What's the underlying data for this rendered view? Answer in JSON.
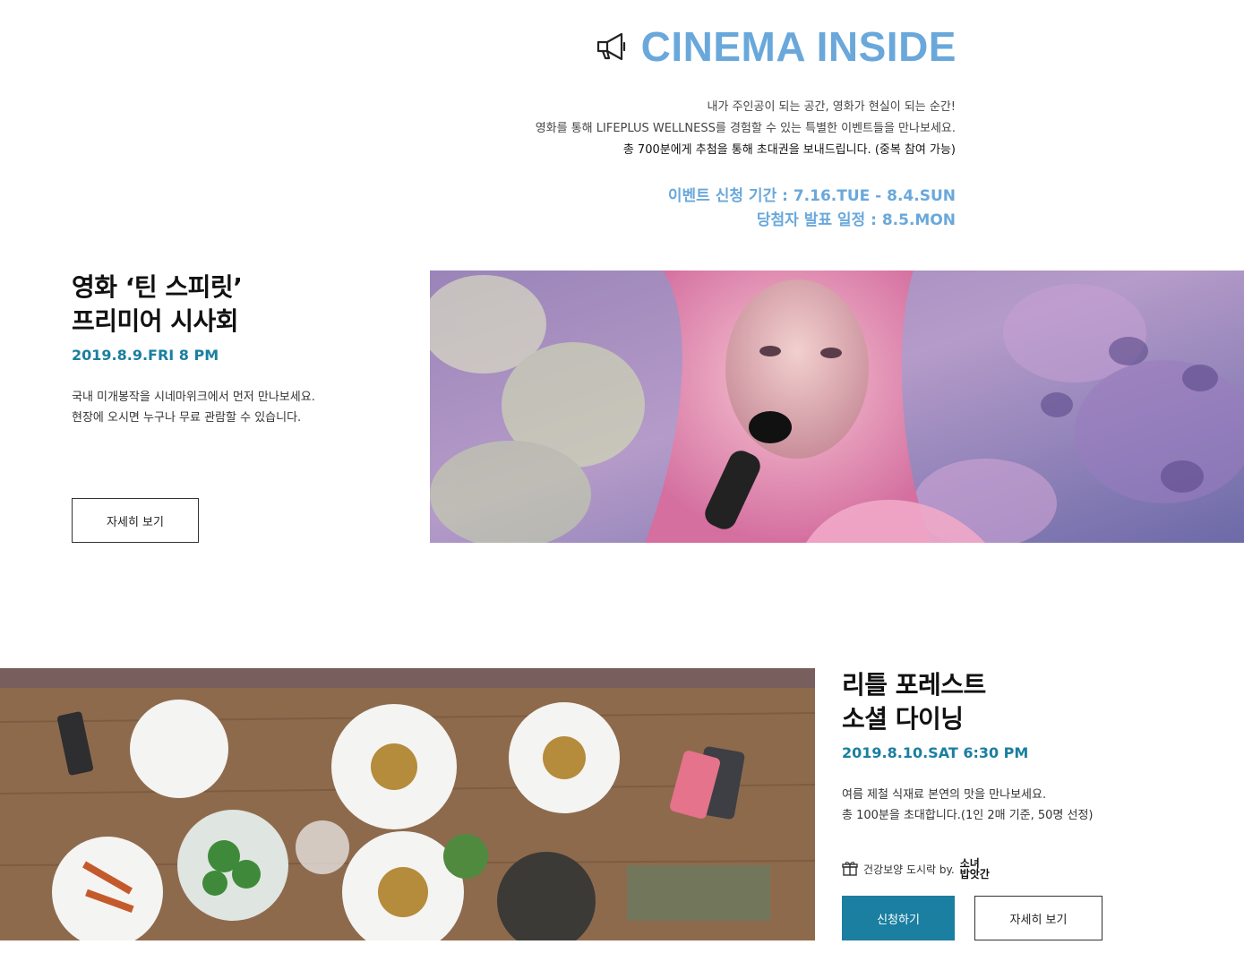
{
  "header": {
    "title": "CINEMA INSIDE",
    "intro": [
      "내가 주인공이 되는 공간, 영화가 현실이 되는 순간!",
      "영화를 통해 LIFEPLUS WELLNESS를 경험할 수 있는 특별한 이벤트들을 만나보세요.",
      "총 700분에게 추첨을 통해 초대권을 보내드립니다. (중복 참여 가능)"
    ],
    "apply_period": "이벤트 신청 기간 : 7.16.TUE - 8.4.SUN",
    "announce_date": "당첨자 발표 일정 : 8.5.MON"
  },
  "event1": {
    "title_line1": "영화 ‘틴 스피릿’",
    "title_line2": "프리미어 시사회",
    "date": "2019.8.9.FRI 8 PM",
    "desc_line1": "국내 미개봉작을 시네마위크에서 먼저 만나보세요.",
    "desc_line2": "현장에 오시면 누구나 무료 관람할 수 있습니다.",
    "details_label": "자세히 보기"
  },
  "event2": {
    "title_line1": "리틀 포레스트",
    "title_line2": "소셜 다이닝",
    "date": "2019.8.10.SAT 6:30 PM",
    "desc_line1": "여름 제철 식재료 본연의 맛을 만나보세요.",
    "desc_line2": "총 100분을 초대합니다.(1인 2매 기준, 50명 선정)",
    "gift_text": "건강보양 도시락 by.",
    "brand_line1": "소녀",
    "brand_line2": "밥앗간",
    "apply_label": "신청하기",
    "details_label": "자세히 보기"
  },
  "colors": {
    "accent_blue": "#6aa8db",
    "teal": "#1a7fa0"
  }
}
